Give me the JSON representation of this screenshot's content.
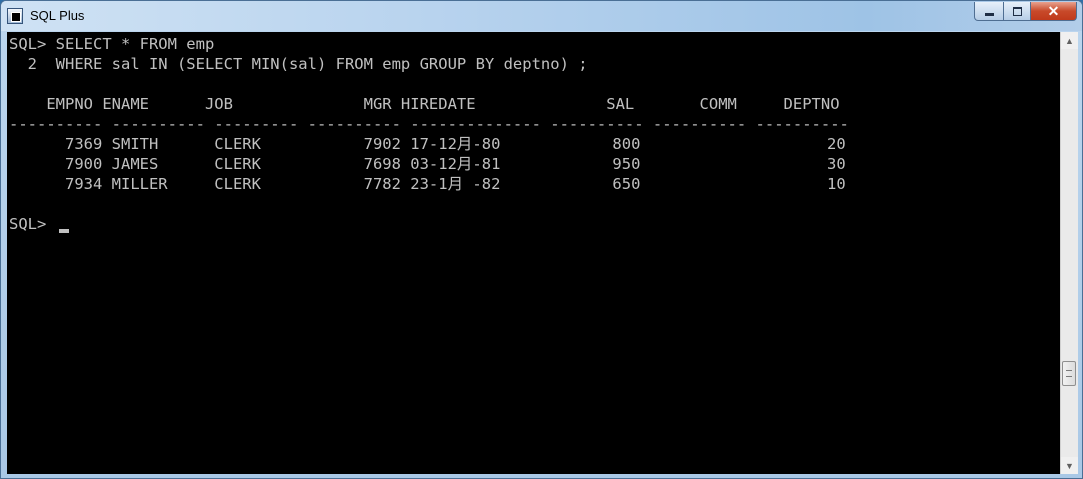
{
  "window": {
    "title": "SQL Plus",
    "icon": "sqlplus-app-icon",
    "controls": {
      "minimize_icon": "minimize-icon",
      "maximize_icon": "maximize-icon",
      "close_glyph": "✕"
    }
  },
  "console": {
    "prompt_line_1": "SQL> SELECT * FROM emp",
    "prompt_line_2": "  2  WHERE sal IN (SELECT MIN(sal) FROM emp GROUP BY deptno) ;",
    "header": "    EMPNO ENAME      JOB              MGR HIREDATE              SAL       COMM     DEPTNO",
    "separator": "---------- ---------- --------- ---------- -------------- ---------- ---------- ----------",
    "rows": [
      "      7369 SMITH      CLERK           7902 17-12月-80            800                    20",
      "      7900 JAMES      CLERK           7698 03-12月-81            950                    30",
      "      7934 MILLER     CLERK           7782 23-1月 -82            650                    10"
    ],
    "final_prompt": "SQL> "
  },
  "scrollbar": {
    "up_glyph": "▲",
    "down_glyph": "▼"
  },
  "colors": {
    "console_bg": "#000000",
    "console_fg": "#c0c0c0",
    "close_button": "#c84a2a"
  }
}
